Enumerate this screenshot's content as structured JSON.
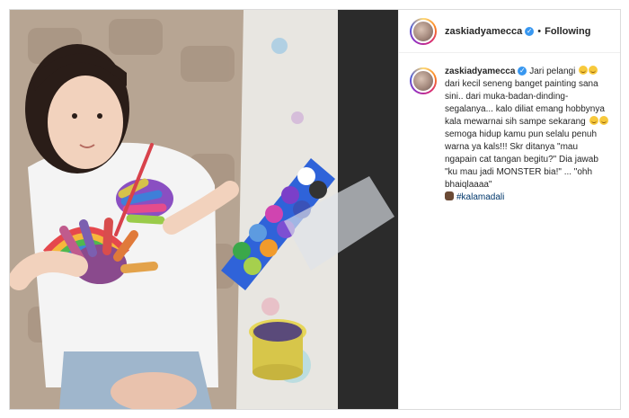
{
  "post": {
    "username": "zaskiadyamecca",
    "follow_status": "Following",
    "separator": "•",
    "caption": {
      "username": "zaskiadyamecca",
      "line1": "Jari pelangi",
      "line2": "dari kecil seneng banget painting sana sini.. dari muka-badan-dinding-segalanya... kalo diliat emang hobbynya kala mewarnai sih sampe sekarang",
      "line3": "semoga hidup kamu pun selalu penuh warna ya kals!!! Skr ditanya \"mau ngapain cat tangan begitu?\" Dia jawab \"ku mau jadi MONSTER bia!\" ... \"ohh bhaiqlaaaa\"",
      "hashtag": "#kalamadali"
    }
  },
  "icons": {
    "verified": "verified-badge-icon",
    "emoji_laugh": "grinning-sweat-emoji",
    "emoji_smile": "smiling-emoji",
    "monkey": "monkey-emoji"
  },
  "colors": {
    "verified_blue": "#3897f0",
    "hashtag": "#00376b",
    "border": "#dbdbdb",
    "text": "#262626"
  }
}
